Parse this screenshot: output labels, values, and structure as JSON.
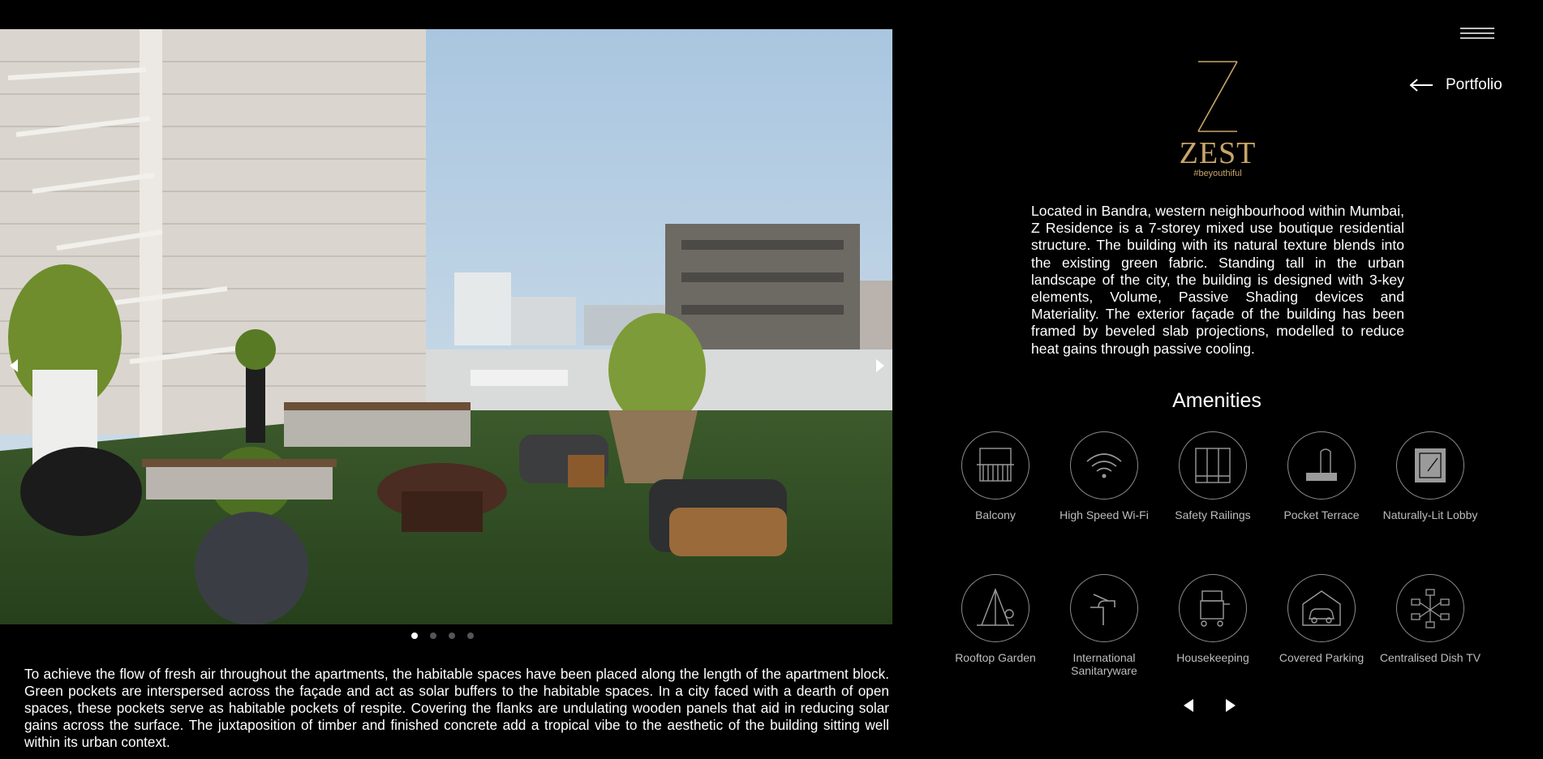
{
  "nav": {
    "portfolio_label": "Portfolio"
  },
  "logo": {
    "wordmark": "ZEST",
    "tagline": "#beyouthiful"
  },
  "gallery": {
    "slides_count": 4,
    "active_slide": 1
  },
  "description_left": "To achieve the flow of fresh air throughout the apartments, the habitable spaces have been placed along the length of the apartment block. Green pockets are interspersed across the façade and act as solar buffers to the habitable spaces. In a city faced with a dearth of open spaces, these pockets serve as habitable pockets of respite. Covering the flanks are undulating wooden panels that aid in reducing solar gains across the surface. The juxtaposition of timber and finished concrete add a tropical vibe to the aesthetic of the building sitting well within its urban context.",
  "description_right": "Located in Bandra, western neighbourhood within Mumbai, Z Residence is a 7-storey mixed use boutique residential structure. The building with its natural texture blends into the existing green fabric. Standing tall in the urban landscape of the city, the building is designed with 3-key elements, Volume, Passive Shading devices and Materiality. The exterior façade of the building has been framed by beveled slab projections, modelled to reduce heat gains through passive cooling.",
  "amenities": {
    "title": "Amenities",
    "items": [
      {
        "label": "Balcony",
        "icon": "balcony-icon"
      },
      {
        "label": "High Speed Wi-Fi",
        "icon": "wifi-icon"
      },
      {
        "label": "Safety Railings",
        "icon": "railings-icon"
      },
      {
        "label": "Pocket Terrace",
        "icon": "terrace-icon"
      },
      {
        "label": "Naturally-Lit Lobby",
        "icon": "lobby-icon"
      },
      {
        "label": "Rooftop Garden",
        "icon": "garden-icon"
      },
      {
        "label": "International Sanitaryware",
        "icon": "faucet-icon"
      },
      {
        "label": "Housekeeping",
        "icon": "housekeeping-cart-icon"
      },
      {
        "label": "Covered Parking",
        "icon": "parking-icon"
      },
      {
        "label": "Centralised Dish TV",
        "icon": "network-icon"
      }
    ]
  },
  "colors": {
    "background": "#000000",
    "accent_gold": "#c9a56a",
    "icon_gray": "#9a9a9a",
    "label_gray": "#bdbdbd"
  }
}
